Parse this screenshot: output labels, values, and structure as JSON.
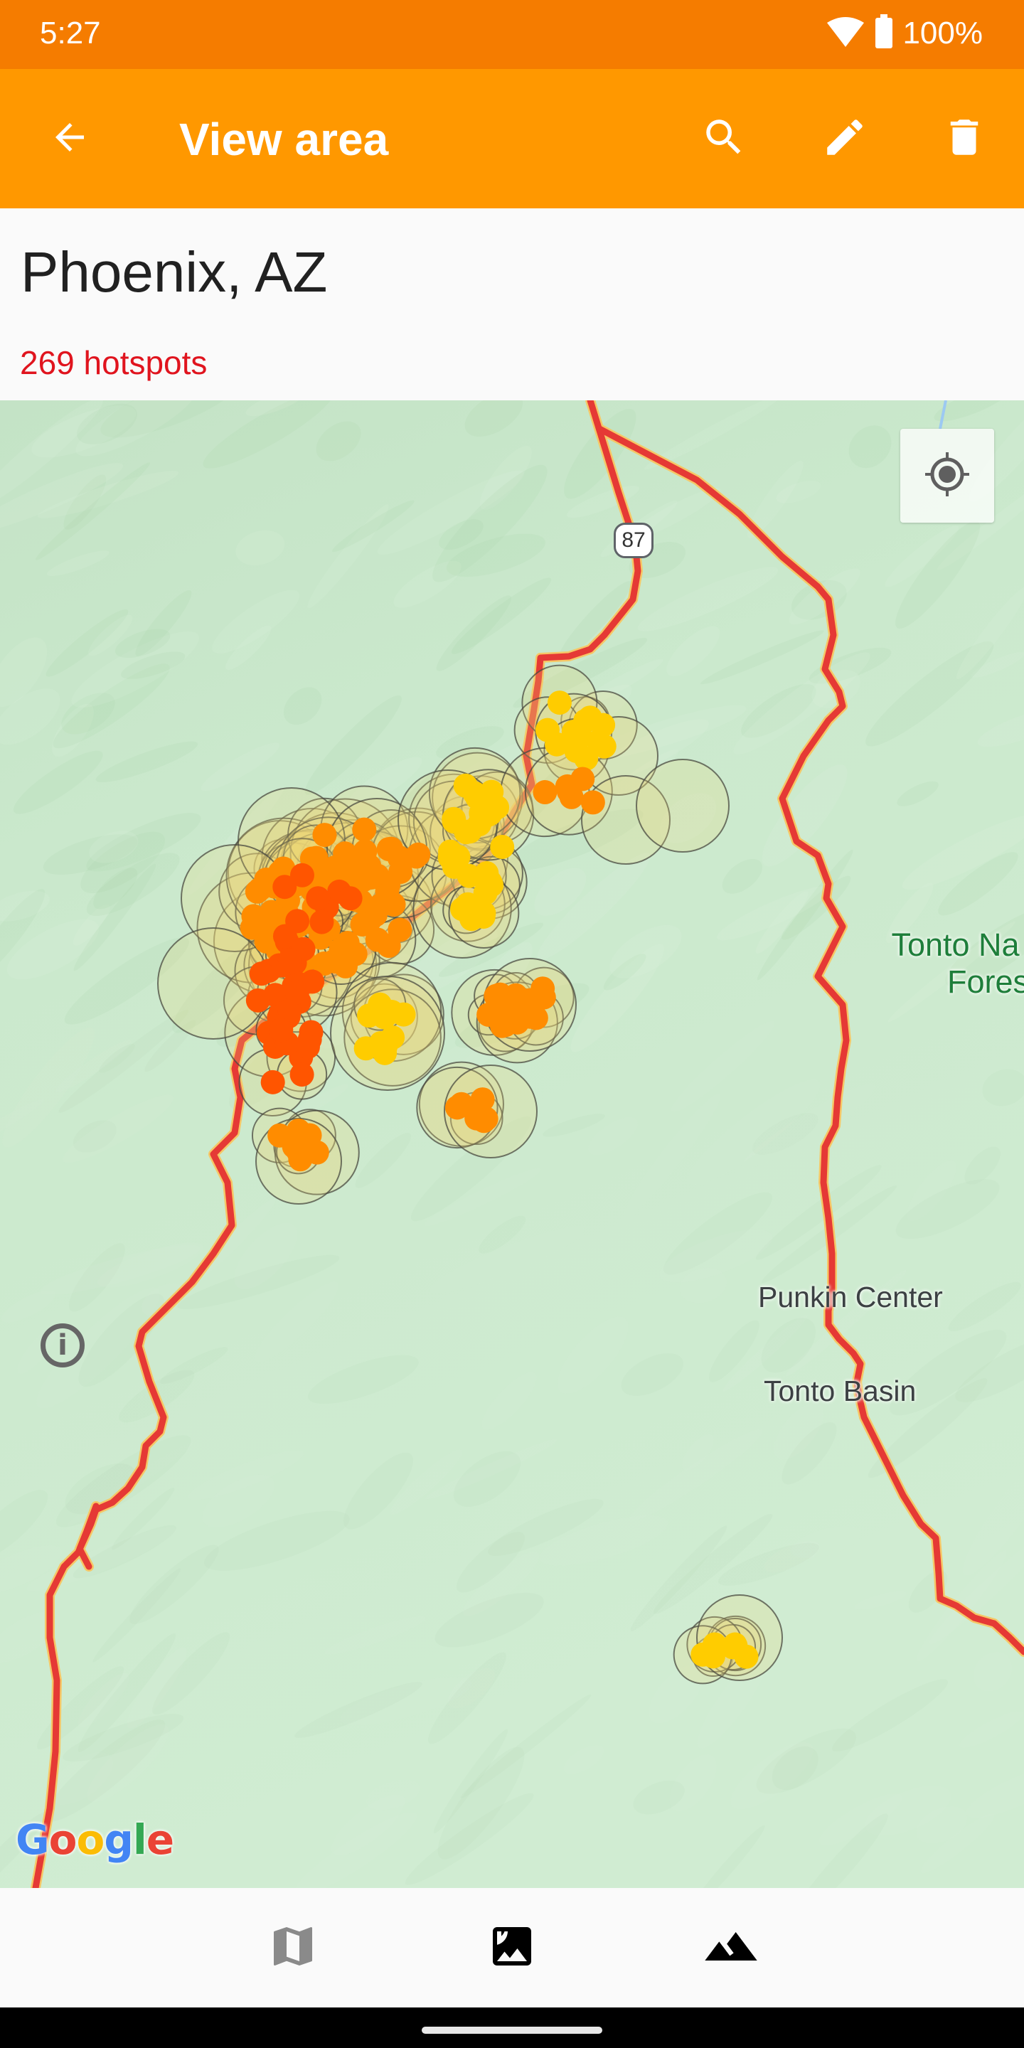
{
  "status_bar": {
    "time": "5:27",
    "battery_percent": "100%",
    "icons": [
      "wifi-icon",
      "battery-icon"
    ],
    "color": "#F57C00"
  },
  "app_bar": {
    "title": "View area",
    "color": "#FF9800",
    "actions": [
      {
        "name": "back",
        "icon": "arrow-back-icon"
      },
      {
        "name": "search",
        "icon": "search-icon"
      },
      {
        "name": "edit",
        "icon": "pencil-icon"
      },
      {
        "name": "delete",
        "icon": "trash-icon"
      }
    ]
  },
  "header": {
    "place": "Phoenix, AZ",
    "hotspot_count_label": "269 hotspots",
    "hotspot_count": 269,
    "count_color": "#E0141E"
  },
  "map": {
    "route_badge": "87",
    "labels": {
      "forest_line1": "Tonto Na",
      "forest_line2": "Fores",
      "town1": "Punkin Center",
      "town2": "Tonto Basin"
    },
    "attribution": {
      "logo": [
        "G",
        "o",
        "o",
        "g",
        "l",
        "e"
      ],
      "logo_colors": [
        "#4285F4",
        "#EA4335",
        "#FBBC05",
        "#4285F4",
        "#34A853",
        "#EA4335"
      ],
      "info_glyph": "i"
    },
    "hotspot_colors": {
      "newest": "#FF5500",
      "recent": "#FF8C00",
      "older": "#FFCC00"
    },
    "road_color": "#E53935"
  },
  "bottom_nav": {
    "items": [
      {
        "name": "map",
        "icon": "map-icon",
        "active": false
      },
      {
        "name": "satellite-image",
        "icon": "image-icon",
        "active": true
      },
      {
        "name": "terrain",
        "icon": "terrain-icon",
        "active": false
      }
    ]
  }
}
